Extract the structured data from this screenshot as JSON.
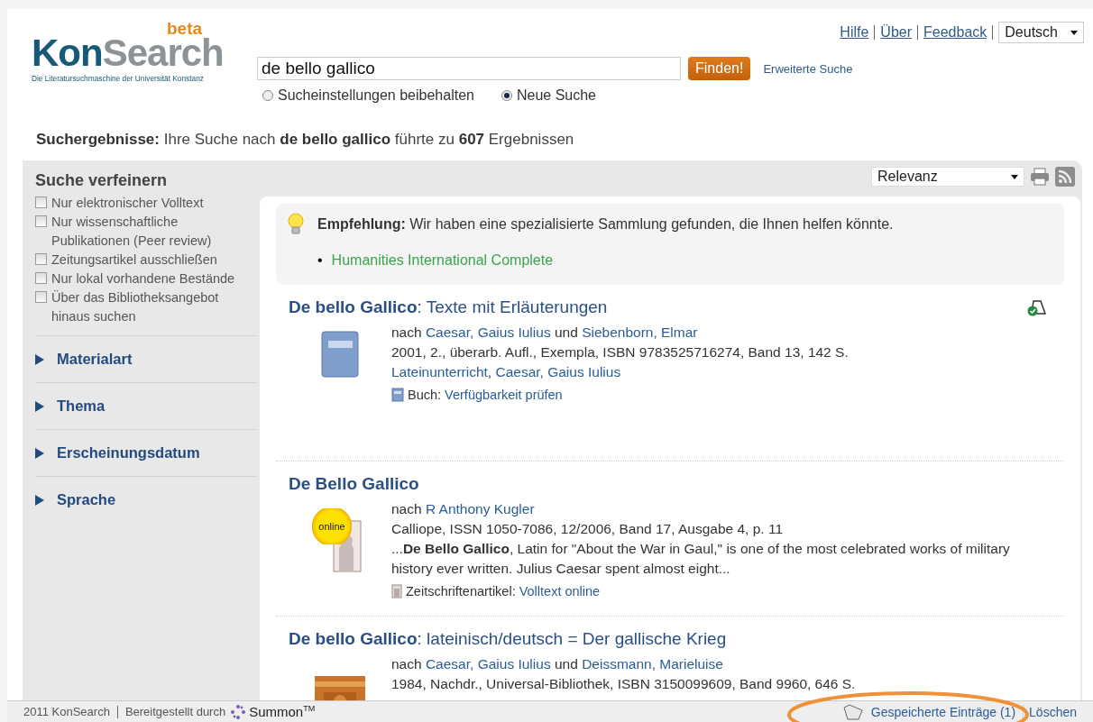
{
  "header": {
    "logo": {
      "name_a": "Kon",
      "name_b": "Search",
      "badge": "beta",
      "tagline": "Die Literatursuchmaschine der Universität Konstanz"
    },
    "search": {
      "value": "de bello gallico",
      "button": "Finden!",
      "advanced": "Erweiterte Suche"
    },
    "search_modes": [
      {
        "label": "Sucheinstellungen beibehalten",
        "selected": false
      },
      {
        "label": "Neue Suche",
        "selected": true
      }
    ],
    "top_links": [
      "Hilfe",
      "Über",
      "Feedback"
    ],
    "language": "Deutsch"
  },
  "summary": "**Suchergebnisse:** Ihre Suche nach **de bello gallico** führte zu **607** Ergebnissen",
  "sidebar": {
    "title": "Suche verfeinern",
    "filters": [
      {
        "label": "Nur elektronischer Volltext",
        "checked": false
      },
      {
        "label": "Nur wissenschaftliche Publikationen (Peer review)",
        "checked": false
      },
      {
        "label": "Zeitungsartikel ausschließen",
        "checked": false
      },
      {
        "label": "Nur lokal vorhandene Bestände",
        "checked": false
      },
      {
        "label": "Über das Bibliotheksangebot hinaus suchen",
        "checked": false
      }
    ],
    "facets": [
      {
        "label": "Materialart",
        "expanded": false
      },
      {
        "label": "Thema",
        "expanded": false
      },
      {
        "label": "Erscheinungsdatum",
        "expanded": false
      },
      {
        "label": "Sprache",
        "expanded": false
      }
    ]
  },
  "toolbar": {
    "sort": "Relevanz"
  },
  "recommendation": {
    "text": "**Empfehlung:** Wir haben eine spezialisierte Sammlung gefunden, die Ihnen helfen könnte.",
    "bullet": "•",
    "links": [
      "Humanities International Complete"
    ]
  },
  "results": [
    {
      "title": "De bello Gallico",
      "subtitle": ": Texte mit Erläuterungen",
      "saved": true,
      "thumbnail": {
        "kind": "book"
      },
      "by": "nach",
      "and": "und",
      "authors": [
        "Caesar, Gaius Iulius",
        "Siebenborn, Elmar"
      ],
      "details": "2001, 2., überarb. Aufl., Exempla, ISBN 9783525716274, Band 13, 142 S.",
      "subjects": [
        "Lateinunterricht",
        "Caesar, Gaius Iulius"
      ],
      "subject_separator": ",",
      "format": {
        "kind": "book",
        "label": "Buch:",
        "link": "Verfügbarkeit prüfen"
      }
    },
    {
      "title": "De Bello Gallico",
      "saved": false,
      "thumbnail": {
        "kind": "online",
        "badge": "online"
      },
      "by": "nach",
      "authors": [
        "R Anthony Kugler"
      ],
      "details": "Calliope, ISSN 1050-7086, 12/2006, Band 17, Ausgabe 4, p. 11",
      "snippet": "...**De Bello Gallico**, Latin for \"About the War in Gaul,\" is one of the most celebrated works of military history ever written. Julius Caesar spent almost eight...",
      "format": {
        "kind": "journal",
        "label": "Zeitschriftenartikel:",
        "link": "Volltext online"
      }
    },
    {
      "title": "De bello Gallico",
      "subtitle": ": lateinisch/deutsch = Der gallische Krieg",
      "saved": false,
      "thumbnail": {
        "kind": "picture"
      },
      "by": "nach",
      "and": "und",
      "authors": [
        "Caesar, Gaius Iulius",
        "Deissmann, Marieluise"
      ],
      "details": "1984, Nachdr., Universal-Bibliothek, ISBN 3150099609, Band 9960, 646 S."
    }
  ],
  "footer": {
    "copyright": "2011 KonSearch",
    "provided_by": "Bereitgestellt durch",
    "provider": "Summon$^{TM}$",
    "saved_items": "Gespeicherte Einträge (1)",
    "clear": "Löschen"
  }
}
